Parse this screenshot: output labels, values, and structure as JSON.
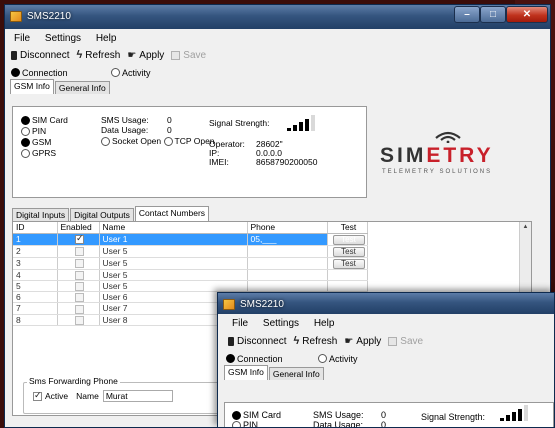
{
  "app": {
    "title": "SMS2210"
  },
  "menu": {
    "file": "File",
    "settings": "Settings",
    "help": "Help"
  },
  "toolbar": {
    "disconnect": "Disconnect",
    "refresh": "Refresh",
    "apply": "Apply",
    "save": "Save"
  },
  "mode": {
    "connection": "Connection",
    "activity": "Activity",
    "selected": "Connection"
  },
  "tabs": {
    "gsm_info": "GSM Info",
    "general_info": "General Info"
  },
  "gsm": {
    "sim_card": "SIM Card",
    "pin": "PIN",
    "gsm": "GSM",
    "gprs": "GPRS",
    "sms_usage_label": "SMS Usage:",
    "sms_usage_value": "0",
    "data_usage_label": "Data Usage:",
    "data_usage_value": "0",
    "socket_open": "Socket Open",
    "tcp_open": "TCP Open",
    "signal_label": "Signal Strength:",
    "signal_level": 4,
    "operator_label": "Operator:",
    "operator_value": "28602\"",
    "ip_label": "IP:",
    "ip_value": "0.0.0.0",
    "imei_label": "IMEI:",
    "imei_value": "8658790200050"
  },
  "logo": {
    "brand_left": "SIM",
    "brand_right": "ETRY",
    "tagline": "TELEMETRY SOLUTIONS"
  },
  "sub_tabs": {
    "digital_inputs": "Digital Inputs",
    "digital_outputs": "Digital Outputs",
    "contact_numbers": "Contact Numbers"
  },
  "contacts": {
    "headers": {
      "id": "ID",
      "enabled": "Enabled",
      "name": "Name",
      "phone": "Phone",
      "test": "Test"
    },
    "rows": [
      {
        "id": "1",
        "enabled": true,
        "name": "User 1",
        "phone": "05,___",
        "test": "Test"
      },
      {
        "id": "2",
        "enabled": false,
        "name": "User 5",
        "phone": "",
        "test": "Test"
      },
      {
        "id": "3",
        "enabled": false,
        "name": "User 5",
        "phone": "",
        "test": "Test"
      },
      {
        "id": "4",
        "enabled": false,
        "name": "User 5",
        "phone": "",
        "test": ""
      },
      {
        "id": "5",
        "enabled": false,
        "name": "User 5",
        "phone": "",
        "test": ""
      },
      {
        "id": "6",
        "enabled": false,
        "name": "User 6",
        "phone": "",
        "test": ""
      },
      {
        "id": "7",
        "enabled": false,
        "name": "User 7",
        "phone": "",
        "test": ""
      },
      {
        "id": "8",
        "enabled": false,
        "name": "User 8",
        "phone": "",
        "test": ""
      }
    ]
  },
  "forwarding": {
    "group_label": "Sms Forwarding Phone",
    "active_label": "Active",
    "name_label": "Name",
    "name_value": "Murat"
  }
}
